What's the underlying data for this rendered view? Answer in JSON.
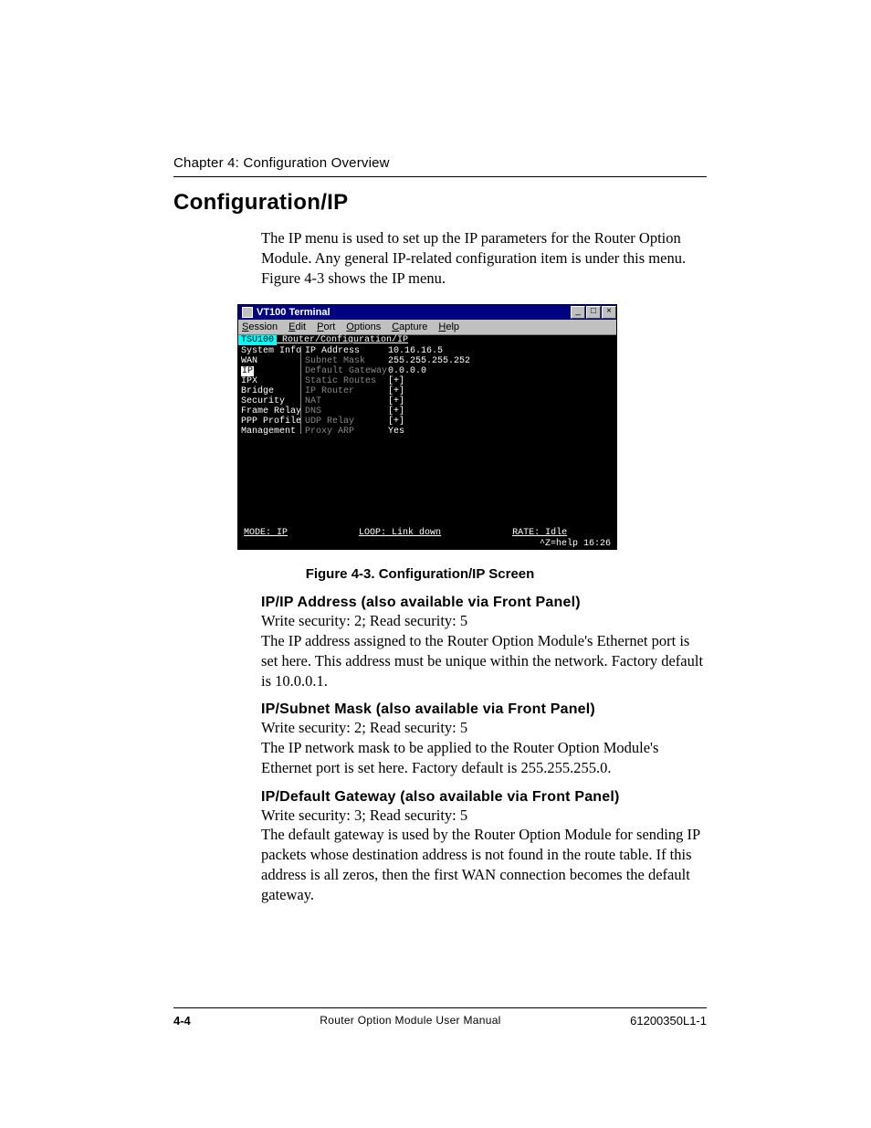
{
  "chapter_line": "Chapter 4:  Configuration Overview",
  "heading": "Configuration/IP",
  "intro_text": "The IP menu is used to set up the IP parameters for the Router Option Module. Any general IP-related configuration item is under this menu. Figure 4-3 shows the IP menu.",
  "terminal": {
    "window_title": "VT100 Terminal",
    "win_buttons": {
      "min": "_",
      "max": "□",
      "close": "×"
    },
    "menubar": {
      "session": "Session",
      "edit": "Edit",
      "port": "Port",
      "options": "Options",
      "capture": "Capture",
      "help": "Help"
    },
    "header_tag": "TSU100",
    "header_path": " Router/Configuration/IP",
    "left_menu": {
      "l0": "System Info",
      "l1": "WAN",
      "l2": "IP",
      "l3": "IPX",
      "l4": "Bridge",
      "l5": "Security",
      "l6": "Frame Relay",
      "l7": "PPP Profile",
      "l8": "Management"
    },
    "mid_menu": {
      "m0": "IP Address",
      "m1": "Subnet Mask",
      "m2": "Default Gateway",
      "m3": "Static Routes",
      "m4": "IP Router",
      "m5": "NAT",
      "m6": "DNS",
      "m7": "UDP Relay",
      "m8": "Proxy ARP"
    },
    "values": {
      "v0": "10.16.16.5",
      "v1": "255.255.255.252",
      "v2": "0.0.0.0",
      "v3": "[+]",
      "v4": "[+]",
      "v5": "[+]",
      "v6": "[+]",
      "v7": "[+]",
      "v8": "Yes"
    },
    "status": {
      "mode": "MODE: IP",
      "loop": "LOOP: Link down",
      "rate": "RATE: Idle",
      "help": "^Z=help 16:26"
    }
  },
  "figure_caption": "Figure 4-3.  Configuration/IP Screen",
  "sections": {
    "s1_h": "IP/IP Address (also available via Front Panel)",
    "s1_b": "Write security: 2; Read security: 5\nThe IP address assigned to the Router Option Module's Ethernet port is set here.  This address must be unique within the network.  Factory default is 10.0.0.1.",
    "s2_h": "IP/Subnet Mask (also available via Front Panel)",
    "s2_b": "Write security: 2; Read security: 5\nThe IP network mask to be applied to the Router Option Module's Ethernet port is set here.  Factory default is 255.255.255.0.",
    "s3_h": "IP/Default Gateway (also available via Front Panel)",
    "s3_b": "Write security: 3; Read security: 5\nThe default gateway is used by the Router Option Module for sending IP packets whose destination address is not found in the route table.  If this address is all zeros, then the first WAN connection becomes the default gateway."
  },
  "footer": {
    "page_num": "4-4",
    "center": "Router Option Module User Manual",
    "right": "61200350L1-1"
  }
}
